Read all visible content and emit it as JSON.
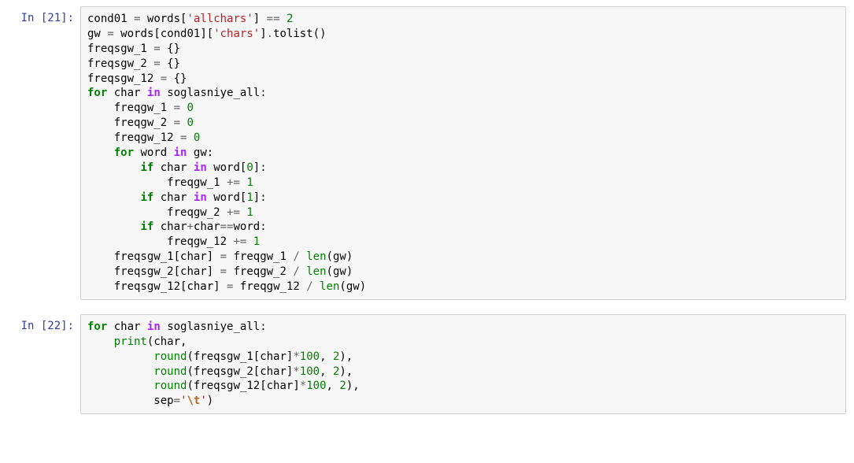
{
  "cells": [
    {
      "prompt": "In [21]:",
      "code": [
        [
          {
            "cls": "n",
            "t": "cond01"
          },
          {
            "cls": "p",
            "t": " "
          },
          {
            "cls": "o",
            "t": "="
          },
          {
            "cls": "p",
            "t": " "
          },
          {
            "cls": "n",
            "t": "words"
          },
          {
            "cls": "p",
            "t": "["
          },
          {
            "cls": "s",
            "t": "'allchars'"
          },
          {
            "cls": "p",
            "t": "]"
          },
          {
            "cls": "p",
            "t": " "
          },
          {
            "cls": "o",
            "t": "=="
          },
          {
            "cls": "p",
            "t": " "
          },
          {
            "cls": "m",
            "t": "2"
          }
        ],
        [
          {
            "cls": "n",
            "t": "gw"
          },
          {
            "cls": "p",
            "t": " "
          },
          {
            "cls": "o",
            "t": "="
          },
          {
            "cls": "p",
            "t": " "
          },
          {
            "cls": "n",
            "t": "words"
          },
          {
            "cls": "p",
            "t": "["
          },
          {
            "cls": "n",
            "t": "cond01"
          },
          {
            "cls": "p",
            "t": "]["
          },
          {
            "cls": "s",
            "t": "'chars'"
          },
          {
            "cls": "p",
            "t": "]"
          },
          {
            "cls": "o",
            "t": "."
          },
          {
            "cls": "n",
            "t": "tolist"
          },
          {
            "cls": "p",
            "t": "()"
          }
        ],
        [
          {
            "cls": "n",
            "t": "freqsgw_1"
          },
          {
            "cls": "p",
            "t": " "
          },
          {
            "cls": "o",
            "t": "="
          },
          {
            "cls": "p",
            "t": " "
          },
          {
            "cls": "p",
            "t": "{}"
          }
        ],
        [
          {
            "cls": "n",
            "t": "freqsgw_2"
          },
          {
            "cls": "p",
            "t": " "
          },
          {
            "cls": "o",
            "t": "="
          },
          {
            "cls": "p",
            "t": " "
          },
          {
            "cls": "p",
            "t": "{}"
          }
        ],
        [
          {
            "cls": "n",
            "t": "freqsgw_12"
          },
          {
            "cls": "p",
            "t": " "
          },
          {
            "cls": "o",
            "t": "="
          },
          {
            "cls": "p",
            "t": " "
          },
          {
            "cls": "p",
            "t": "{}"
          }
        ],
        [
          {
            "cls": "k",
            "t": "for"
          },
          {
            "cls": "p",
            "t": " "
          },
          {
            "cls": "n",
            "t": "char"
          },
          {
            "cls": "p",
            "t": " "
          },
          {
            "cls": "op",
            "t": "in"
          },
          {
            "cls": "p",
            "t": " "
          },
          {
            "cls": "n",
            "t": "soglasniye_all"
          },
          {
            "cls": "p",
            "t": ":"
          }
        ],
        [
          {
            "cls": "p",
            "t": "    "
          },
          {
            "cls": "n",
            "t": "freqgw_1"
          },
          {
            "cls": "p",
            "t": " "
          },
          {
            "cls": "o",
            "t": "="
          },
          {
            "cls": "p",
            "t": " "
          },
          {
            "cls": "m",
            "t": "0"
          }
        ],
        [
          {
            "cls": "p",
            "t": "    "
          },
          {
            "cls": "n",
            "t": "freqgw_2"
          },
          {
            "cls": "p",
            "t": " "
          },
          {
            "cls": "o",
            "t": "="
          },
          {
            "cls": "p",
            "t": " "
          },
          {
            "cls": "m",
            "t": "0"
          }
        ],
        [
          {
            "cls": "p",
            "t": "    "
          },
          {
            "cls": "n",
            "t": "freqgw_12"
          },
          {
            "cls": "p",
            "t": " "
          },
          {
            "cls": "o",
            "t": "="
          },
          {
            "cls": "p",
            "t": " "
          },
          {
            "cls": "m",
            "t": "0"
          }
        ],
        [
          {
            "cls": "p",
            "t": "    "
          },
          {
            "cls": "k",
            "t": "for"
          },
          {
            "cls": "p",
            "t": " "
          },
          {
            "cls": "n",
            "t": "word"
          },
          {
            "cls": "p",
            "t": " "
          },
          {
            "cls": "op",
            "t": "in"
          },
          {
            "cls": "p",
            "t": " "
          },
          {
            "cls": "n",
            "t": "gw"
          },
          {
            "cls": "p",
            "t": ":"
          }
        ],
        [
          {
            "cls": "p",
            "t": "        "
          },
          {
            "cls": "k",
            "t": "if"
          },
          {
            "cls": "p",
            "t": " "
          },
          {
            "cls": "n",
            "t": "char"
          },
          {
            "cls": "p",
            "t": " "
          },
          {
            "cls": "op",
            "t": "in"
          },
          {
            "cls": "p",
            "t": " "
          },
          {
            "cls": "n",
            "t": "word"
          },
          {
            "cls": "p",
            "t": "["
          },
          {
            "cls": "m",
            "t": "0"
          },
          {
            "cls": "p",
            "t": "]:"
          }
        ],
        [
          {
            "cls": "p",
            "t": "            "
          },
          {
            "cls": "n",
            "t": "freqgw_1"
          },
          {
            "cls": "p",
            "t": " "
          },
          {
            "cls": "o",
            "t": "+="
          },
          {
            "cls": "p",
            "t": " "
          },
          {
            "cls": "m",
            "t": "1"
          }
        ],
        [
          {
            "cls": "p",
            "t": "        "
          },
          {
            "cls": "k",
            "t": "if"
          },
          {
            "cls": "p",
            "t": " "
          },
          {
            "cls": "n",
            "t": "char"
          },
          {
            "cls": "p",
            "t": " "
          },
          {
            "cls": "op",
            "t": "in"
          },
          {
            "cls": "p",
            "t": " "
          },
          {
            "cls": "n",
            "t": "word"
          },
          {
            "cls": "p",
            "t": "["
          },
          {
            "cls": "m",
            "t": "1"
          },
          {
            "cls": "p",
            "t": "]:"
          }
        ],
        [
          {
            "cls": "p",
            "t": "            "
          },
          {
            "cls": "n",
            "t": "freqgw_2"
          },
          {
            "cls": "p",
            "t": " "
          },
          {
            "cls": "o",
            "t": "+="
          },
          {
            "cls": "p",
            "t": " "
          },
          {
            "cls": "m",
            "t": "1"
          }
        ],
        [
          {
            "cls": "p",
            "t": "        "
          },
          {
            "cls": "k",
            "t": "if"
          },
          {
            "cls": "p",
            "t": " "
          },
          {
            "cls": "n",
            "t": "char"
          },
          {
            "cls": "o",
            "t": "+"
          },
          {
            "cls": "n",
            "t": "char"
          },
          {
            "cls": "o",
            "t": "=="
          },
          {
            "cls": "n",
            "t": "word"
          },
          {
            "cls": "p",
            "t": ":"
          }
        ],
        [
          {
            "cls": "p",
            "t": "            "
          },
          {
            "cls": "n",
            "t": "freqgw_12"
          },
          {
            "cls": "p",
            "t": " "
          },
          {
            "cls": "o",
            "t": "+="
          },
          {
            "cls": "p",
            "t": " "
          },
          {
            "cls": "m",
            "t": "1"
          }
        ],
        [
          {
            "cls": "p",
            "t": "    "
          },
          {
            "cls": "n",
            "t": "freqsgw_1"
          },
          {
            "cls": "p",
            "t": "["
          },
          {
            "cls": "n",
            "t": "char"
          },
          {
            "cls": "p",
            "t": "]"
          },
          {
            "cls": "p",
            "t": " "
          },
          {
            "cls": "o",
            "t": "="
          },
          {
            "cls": "p",
            "t": " "
          },
          {
            "cls": "n",
            "t": "freqgw_1"
          },
          {
            "cls": "p",
            "t": " "
          },
          {
            "cls": "o",
            "t": "/"
          },
          {
            "cls": "p",
            "t": " "
          },
          {
            "cls": "bi",
            "t": "len"
          },
          {
            "cls": "p",
            "t": "("
          },
          {
            "cls": "n",
            "t": "gw"
          },
          {
            "cls": "p",
            "t": ")"
          }
        ],
        [
          {
            "cls": "p",
            "t": "    "
          },
          {
            "cls": "n",
            "t": "freqsgw_2"
          },
          {
            "cls": "p",
            "t": "["
          },
          {
            "cls": "n",
            "t": "char"
          },
          {
            "cls": "p",
            "t": "]"
          },
          {
            "cls": "p",
            "t": " "
          },
          {
            "cls": "o",
            "t": "="
          },
          {
            "cls": "p",
            "t": " "
          },
          {
            "cls": "n",
            "t": "freqgw_2"
          },
          {
            "cls": "p",
            "t": " "
          },
          {
            "cls": "o",
            "t": "/"
          },
          {
            "cls": "p",
            "t": " "
          },
          {
            "cls": "bi",
            "t": "len"
          },
          {
            "cls": "p",
            "t": "("
          },
          {
            "cls": "n",
            "t": "gw"
          },
          {
            "cls": "p",
            "t": ")"
          }
        ],
        [
          {
            "cls": "p",
            "t": "    "
          },
          {
            "cls": "n",
            "t": "freqsgw_12"
          },
          {
            "cls": "p",
            "t": "["
          },
          {
            "cls": "n",
            "t": "char"
          },
          {
            "cls": "p",
            "t": "]"
          },
          {
            "cls": "p",
            "t": " "
          },
          {
            "cls": "o",
            "t": "="
          },
          {
            "cls": "p",
            "t": " "
          },
          {
            "cls": "n",
            "t": "freqgw_12"
          },
          {
            "cls": "p",
            "t": " "
          },
          {
            "cls": "o",
            "t": "/"
          },
          {
            "cls": "p",
            "t": " "
          },
          {
            "cls": "bi",
            "t": "len"
          },
          {
            "cls": "p",
            "t": "("
          },
          {
            "cls": "n",
            "t": "gw"
          },
          {
            "cls": "p",
            "t": ")"
          }
        ]
      ]
    },
    {
      "prompt": "In [22]:",
      "code": [
        [
          {
            "cls": "k",
            "t": "for"
          },
          {
            "cls": "p",
            "t": " "
          },
          {
            "cls": "n",
            "t": "char"
          },
          {
            "cls": "p",
            "t": " "
          },
          {
            "cls": "op",
            "t": "in"
          },
          {
            "cls": "p",
            "t": " "
          },
          {
            "cls": "n",
            "t": "soglasniye_all"
          },
          {
            "cls": "p",
            "t": ":"
          }
        ],
        [
          {
            "cls": "p",
            "t": "    "
          },
          {
            "cls": "bi",
            "t": "print"
          },
          {
            "cls": "p",
            "t": "("
          },
          {
            "cls": "n",
            "t": "char"
          },
          {
            "cls": "p",
            "t": ","
          }
        ],
        [
          {
            "cls": "p",
            "t": "          "
          },
          {
            "cls": "bi",
            "t": "round"
          },
          {
            "cls": "p",
            "t": "("
          },
          {
            "cls": "n",
            "t": "freqsgw_1"
          },
          {
            "cls": "p",
            "t": "["
          },
          {
            "cls": "n",
            "t": "char"
          },
          {
            "cls": "p",
            "t": "]"
          },
          {
            "cls": "o",
            "t": "*"
          },
          {
            "cls": "m",
            "t": "100"
          },
          {
            "cls": "p",
            "t": ", "
          },
          {
            "cls": "m",
            "t": "2"
          },
          {
            "cls": "p",
            "t": "),"
          }
        ],
        [
          {
            "cls": "p",
            "t": "          "
          },
          {
            "cls": "bi",
            "t": "round"
          },
          {
            "cls": "p",
            "t": "("
          },
          {
            "cls": "n",
            "t": "freqsgw_2"
          },
          {
            "cls": "p",
            "t": "["
          },
          {
            "cls": "n",
            "t": "char"
          },
          {
            "cls": "p",
            "t": "]"
          },
          {
            "cls": "o",
            "t": "*"
          },
          {
            "cls": "m",
            "t": "100"
          },
          {
            "cls": "p",
            "t": ", "
          },
          {
            "cls": "m",
            "t": "2"
          },
          {
            "cls": "p",
            "t": "),"
          }
        ],
        [
          {
            "cls": "p",
            "t": "          "
          },
          {
            "cls": "bi",
            "t": "round"
          },
          {
            "cls": "p",
            "t": "("
          },
          {
            "cls": "n",
            "t": "freqsgw_12"
          },
          {
            "cls": "p",
            "t": "["
          },
          {
            "cls": "n",
            "t": "char"
          },
          {
            "cls": "p",
            "t": "]"
          },
          {
            "cls": "o",
            "t": "*"
          },
          {
            "cls": "m",
            "t": "100"
          },
          {
            "cls": "p",
            "t": ", "
          },
          {
            "cls": "m",
            "t": "2"
          },
          {
            "cls": "p",
            "t": "),"
          }
        ],
        [
          {
            "cls": "p",
            "t": "          "
          },
          {
            "cls": "n",
            "t": "sep"
          },
          {
            "cls": "o",
            "t": "="
          },
          {
            "cls": "s",
            "t": "'"
          },
          {
            "cls": "se",
            "t": "\\t"
          },
          {
            "cls": "s",
            "t": "'"
          },
          {
            "cls": "p",
            "t": ")"
          }
        ]
      ]
    }
  ]
}
